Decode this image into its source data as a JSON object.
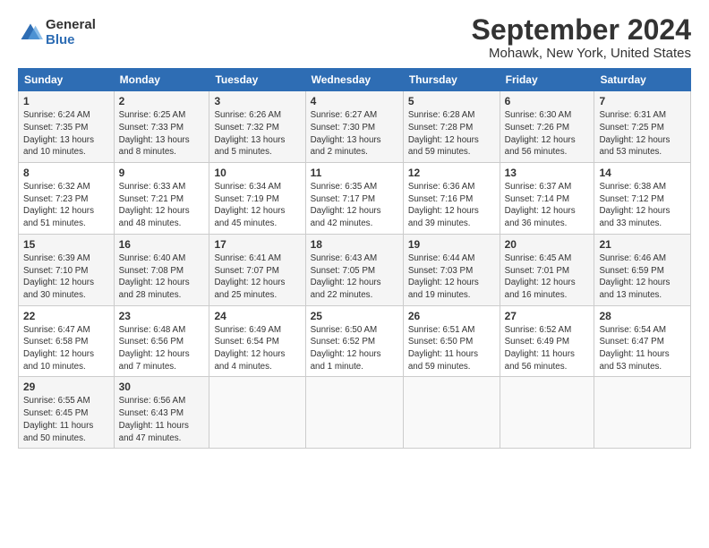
{
  "logo": {
    "general": "General",
    "blue": "Blue"
  },
  "title": "September 2024",
  "location": "Mohawk, New York, United States",
  "days_of_week": [
    "Sunday",
    "Monday",
    "Tuesday",
    "Wednesday",
    "Thursday",
    "Friday",
    "Saturday"
  ],
  "weeks": [
    [
      {
        "day": "1",
        "info": "Sunrise: 6:24 AM\nSunset: 7:35 PM\nDaylight: 13 hours\nand 10 minutes."
      },
      {
        "day": "2",
        "info": "Sunrise: 6:25 AM\nSunset: 7:33 PM\nDaylight: 13 hours\nand 8 minutes."
      },
      {
        "day": "3",
        "info": "Sunrise: 6:26 AM\nSunset: 7:32 PM\nDaylight: 13 hours\nand 5 minutes."
      },
      {
        "day": "4",
        "info": "Sunrise: 6:27 AM\nSunset: 7:30 PM\nDaylight: 13 hours\nand 2 minutes."
      },
      {
        "day": "5",
        "info": "Sunrise: 6:28 AM\nSunset: 7:28 PM\nDaylight: 12 hours\nand 59 minutes."
      },
      {
        "day": "6",
        "info": "Sunrise: 6:30 AM\nSunset: 7:26 PM\nDaylight: 12 hours\nand 56 minutes."
      },
      {
        "day": "7",
        "info": "Sunrise: 6:31 AM\nSunset: 7:25 PM\nDaylight: 12 hours\nand 53 minutes."
      }
    ],
    [
      {
        "day": "8",
        "info": "Sunrise: 6:32 AM\nSunset: 7:23 PM\nDaylight: 12 hours\nand 51 minutes."
      },
      {
        "day": "9",
        "info": "Sunrise: 6:33 AM\nSunset: 7:21 PM\nDaylight: 12 hours\nand 48 minutes."
      },
      {
        "day": "10",
        "info": "Sunrise: 6:34 AM\nSunset: 7:19 PM\nDaylight: 12 hours\nand 45 minutes."
      },
      {
        "day": "11",
        "info": "Sunrise: 6:35 AM\nSunset: 7:17 PM\nDaylight: 12 hours\nand 42 minutes."
      },
      {
        "day": "12",
        "info": "Sunrise: 6:36 AM\nSunset: 7:16 PM\nDaylight: 12 hours\nand 39 minutes."
      },
      {
        "day": "13",
        "info": "Sunrise: 6:37 AM\nSunset: 7:14 PM\nDaylight: 12 hours\nand 36 minutes."
      },
      {
        "day": "14",
        "info": "Sunrise: 6:38 AM\nSunset: 7:12 PM\nDaylight: 12 hours\nand 33 minutes."
      }
    ],
    [
      {
        "day": "15",
        "info": "Sunrise: 6:39 AM\nSunset: 7:10 PM\nDaylight: 12 hours\nand 30 minutes."
      },
      {
        "day": "16",
        "info": "Sunrise: 6:40 AM\nSunset: 7:08 PM\nDaylight: 12 hours\nand 28 minutes."
      },
      {
        "day": "17",
        "info": "Sunrise: 6:41 AM\nSunset: 7:07 PM\nDaylight: 12 hours\nand 25 minutes."
      },
      {
        "day": "18",
        "info": "Sunrise: 6:43 AM\nSunset: 7:05 PM\nDaylight: 12 hours\nand 22 minutes."
      },
      {
        "day": "19",
        "info": "Sunrise: 6:44 AM\nSunset: 7:03 PM\nDaylight: 12 hours\nand 19 minutes."
      },
      {
        "day": "20",
        "info": "Sunrise: 6:45 AM\nSunset: 7:01 PM\nDaylight: 12 hours\nand 16 minutes."
      },
      {
        "day": "21",
        "info": "Sunrise: 6:46 AM\nSunset: 6:59 PM\nDaylight: 12 hours\nand 13 minutes."
      }
    ],
    [
      {
        "day": "22",
        "info": "Sunrise: 6:47 AM\nSunset: 6:58 PM\nDaylight: 12 hours\nand 10 minutes."
      },
      {
        "day": "23",
        "info": "Sunrise: 6:48 AM\nSunset: 6:56 PM\nDaylight: 12 hours\nand 7 minutes."
      },
      {
        "day": "24",
        "info": "Sunrise: 6:49 AM\nSunset: 6:54 PM\nDaylight: 12 hours\nand 4 minutes."
      },
      {
        "day": "25",
        "info": "Sunrise: 6:50 AM\nSunset: 6:52 PM\nDaylight: 12 hours\nand 1 minute."
      },
      {
        "day": "26",
        "info": "Sunrise: 6:51 AM\nSunset: 6:50 PM\nDaylight: 11 hours\nand 59 minutes."
      },
      {
        "day": "27",
        "info": "Sunrise: 6:52 AM\nSunset: 6:49 PM\nDaylight: 11 hours\nand 56 minutes."
      },
      {
        "day": "28",
        "info": "Sunrise: 6:54 AM\nSunset: 6:47 PM\nDaylight: 11 hours\nand 53 minutes."
      }
    ],
    [
      {
        "day": "29",
        "info": "Sunrise: 6:55 AM\nSunset: 6:45 PM\nDaylight: 11 hours\nand 50 minutes."
      },
      {
        "day": "30",
        "info": "Sunrise: 6:56 AM\nSunset: 6:43 PM\nDaylight: 11 hours\nand 47 minutes."
      },
      {
        "day": "",
        "info": ""
      },
      {
        "day": "",
        "info": ""
      },
      {
        "day": "",
        "info": ""
      },
      {
        "day": "",
        "info": ""
      },
      {
        "day": "",
        "info": ""
      }
    ]
  ]
}
